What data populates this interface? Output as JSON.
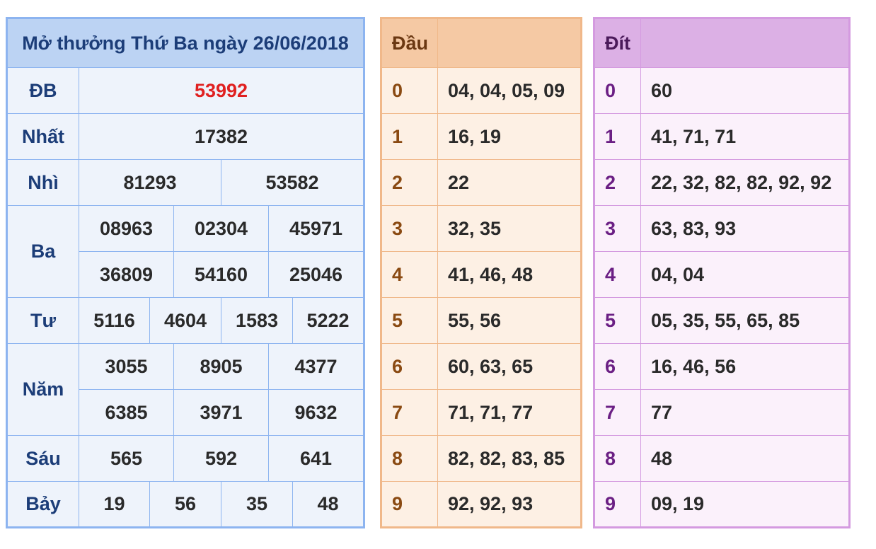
{
  "results": {
    "title": "Mở thưởng Thứ Ba ngày 26/06/2018",
    "db": {
      "label": "ĐB",
      "values": [
        "53992"
      ]
    },
    "nhat": {
      "label": "Nhất",
      "values": [
        "17382"
      ]
    },
    "nhi": {
      "label": "Nhì",
      "values": [
        "81293",
        "53582"
      ]
    },
    "ba": {
      "label": "Ba",
      "values": [
        "08963",
        "02304",
        "45971",
        "36809",
        "54160",
        "25046"
      ]
    },
    "tu": {
      "label": "Tư",
      "values": [
        "5116",
        "4604",
        "1583",
        "5222"
      ]
    },
    "nam": {
      "label": "Năm",
      "values": [
        "3055",
        "8905",
        "4377",
        "6385",
        "3971",
        "9632"
      ]
    },
    "sau": {
      "label": "Sáu",
      "values": [
        "565",
        "592",
        "641"
      ]
    },
    "bay": {
      "label": "Bảy",
      "values": [
        "19",
        "56",
        "35",
        "48"
      ]
    }
  },
  "dau": {
    "header": "Đầu",
    "rows": [
      {
        "digit": "0",
        "values": "04, 04, 05, 09"
      },
      {
        "digit": "1",
        "values": "16, 19"
      },
      {
        "digit": "2",
        "values": "22"
      },
      {
        "digit": "3",
        "values": "32, 35"
      },
      {
        "digit": "4",
        "values": "41, 46, 48"
      },
      {
        "digit": "5",
        "values": "55, 56"
      },
      {
        "digit": "6",
        "values": "60, 63, 65"
      },
      {
        "digit": "7",
        "values": "71, 71, 77"
      },
      {
        "digit": "8",
        "values": "82, 82, 83, 85"
      },
      {
        "digit": "9",
        "values": "92, 92, 93"
      }
    ]
  },
  "dit": {
    "header": "Đít",
    "rows": [
      {
        "digit": "0",
        "values": "60"
      },
      {
        "digit": "1",
        "values": "41, 71, 71"
      },
      {
        "digit": "2",
        "values": "22, 32, 82, 82, 92, 92"
      },
      {
        "digit": "3",
        "values": "63, 83, 93"
      },
      {
        "digit": "4",
        "values": "04, 04"
      },
      {
        "digit": "5",
        "values": "05, 35, 55, 65, 85"
      },
      {
        "digit": "6",
        "values": "16, 46, 56"
      },
      {
        "digit": "7",
        "values": "77"
      },
      {
        "digit": "8",
        "values": "48"
      },
      {
        "digit": "9",
        "values": "09, 19"
      }
    ]
  },
  "colors": {
    "results_border": "#8db4f0",
    "dau_border": "#f0b88a",
    "dit_border": "#d49ae0",
    "special_prize": "#e02020"
  }
}
